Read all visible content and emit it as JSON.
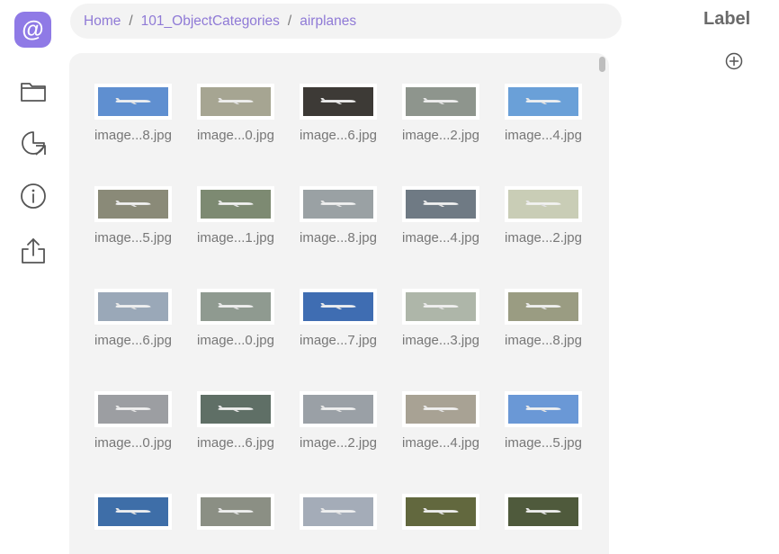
{
  "app": {
    "logo_glyph": "@",
    "accent": "#8f7ae6"
  },
  "sidebar": {
    "items": [
      {
        "name": "folder",
        "icon": "folder-icon"
      },
      {
        "name": "chart",
        "icon": "pie-chart-icon"
      },
      {
        "name": "info",
        "icon": "info-icon"
      },
      {
        "name": "export",
        "icon": "share-export-icon"
      }
    ]
  },
  "breadcrumb": {
    "separator": "/",
    "items": [
      "Home",
      "101_ObjectCategories",
      "airplanes"
    ]
  },
  "gallery": {
    "images": [
      {
        "name": "image...8.jpg",
        "color": "#5f8fd0"
      },
      {
        "name": "image...0.jpg",
        "color": "#a6a592"
      },
      {
        "name": "image...6.jpg",
        "color": "#3d3a36"
      },
      {
        "name": "image...2.jpg",
        "color": "#8e958d"
      },
      {
        "name": "image...4.jpg",
        "color": "#6aa0d8"
      },
      {
        "name": "image...5.jpg",
        "color": "#8a8a78"
      },
      {
        "name": "image...1.jpg",
        "color": "#7d8a72"
      },
      {
        "name": "image...8.jpg",
        "color": "#9aa1a4"
      },
      {
        "name": "image...4.jpg",
        "color": "#6f7a84"
      },
      {
        "name": "image...2.jpg",
        "color": "#c9cdb6"
      },
      {
        "name": "image...6.jpg",
        "color": "#9aa8b8"
      },
      {
        "name": "image...0.jpg",
        "color": "#8f9a90"
      },
      {
        "name": "image...7.jpg",
        "color": "#3f6db2"
      },
      {
        "name": "image...3.jpg",
        "color": "#aeb6a9"
      },
      {
        "name": "image...8.jpg",
        "color": "#9a9c82"
      },
      {
        "name": "image...0.jpg",
        "color": "#9c9ea2"
      },
      {
        "name": "image...6.jpg",
        "color": "#5f6f66"
      },
      {
        "name": "image...2.jpg",
        "color": "#9aa0a6"
      },
      {
        "name": "image...4.jpg",
        "color": "#a8a294"
      },
      {
        "name": "image...5.jpg",
        "color": "#6a98d6"
      },
      {
        "name": "",
        "color": "#3e6ea8"
      },
      {
        "name": "",
        "color": "#8b8f84"
      },
      {
        "name": "",
        "color": "#a4acb8"
      },
      {
        "name": "",
        "color": "#62683e"
      },
      {
        "name": "",
        "color": "#4f5a3c"
      }
    ]
  },
  "label_panel": {
    "title": "Label"
  }
}
